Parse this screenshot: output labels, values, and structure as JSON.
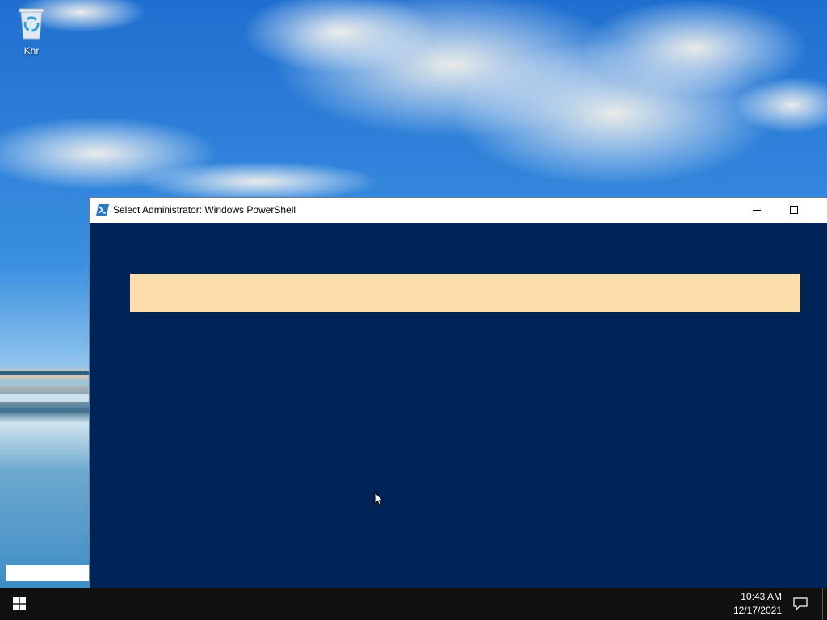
{
  "desktop": {
    "icons": [
      {
        "label": "Khr",
        "icon": "recycle-bin-icon"
      }
    ]
  },
  "window": {
    "title": "Select Administrator: Windows PowerShell",
    "icon": "powershell-icon",
    "controls": [
      "minimize-icon",
      "maximize-icon",
      "close-icon"
    ],
    "colors": {
      "console_background": "#012456",
      "progress_banner": "#ffdeae",
      "titlebar": "#ffffff"
    }
  },
  "taskbar": {
    "start_icon": "windows-logo-icon",
    "time": "10:43 AM",
    "date": "12/17/2021",
    "notification_icon": "action-center-icon",
    "background": "#101010"
  }
}
